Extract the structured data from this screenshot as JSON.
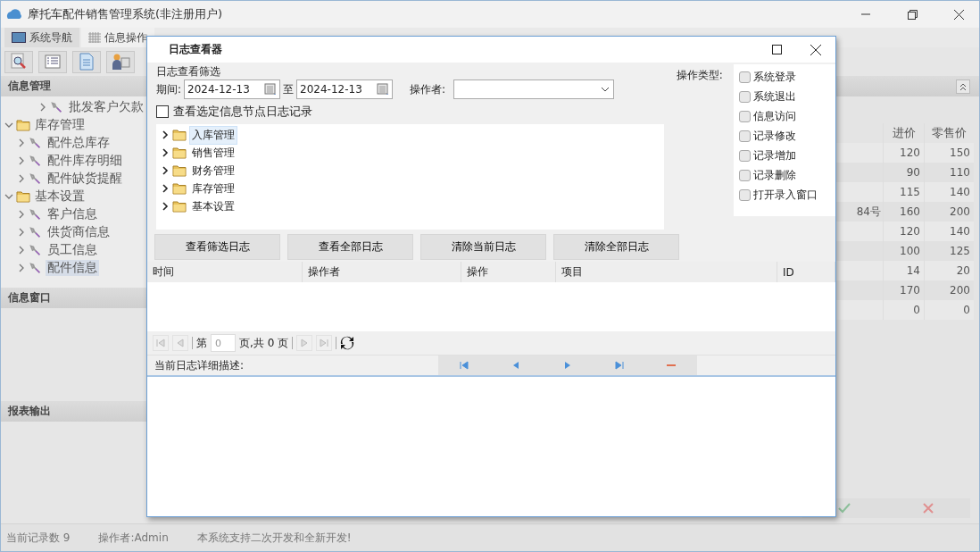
{
  "app": {
    "title": "摩托车配件销售管理系统(非注册用户)"
  },
  "main_tabs": [
    {
      "label": "系统导航",
      "selected": false
    },
    {
      "label": "信息操作",
      "selected": true
    }
  ],
  "nav_panel": {
    "title": "信息管理",
    "tree": [
      {
        "kind": "leaf",
        "label": "批发客户欠款",
        "selected": false
      },
      {
        "kind": "folder",
        "label": "库存管理",
        "expanded": true,
        "children": [
          {
            "kind": "leaf",
            "label": "配件总库存",
            "selected": false
          },
          {
            "kind": "leaf",
            "label": "配件库存明细",
            "selected": false
          },
          {
            "kind": "leaf",
            "label": "配件缺货提醒",
            "selected": false
          }
        ]
      },
      {
        "kind": "folder",
        "label": "基本设置",
        "expanded": true,
        "children": [
          {
            "kind": "leaf",
            "label": "客户信息",
            "selected": false
          },
          {
            "kind": "leaf",
            "label": "供货商信息",
            "selected": false
          },
          {
            "kind": "leaf",
            "label": "员工信息",
            "selected": false
          },
          {
            "kind": "leaf",
            "label": "配件信息",
            "selected": true
          }
        ]
      }
    ]
  },
  "info_window": {
    "title": "信息窗口"
  },
  "report_output": {
    "title": "报表输出"
  },
  "grid": {
    "columns": [
      "进价",
      "零售价"
    ],
    "rows": [
      {
        "cost": "120",
        "retail": "150"
      },
      {
        "cost": "90",
        "retail": "110"
      },
      {
        "cost": "115",
        "retail": "140"
      },
      {
        "column_3": "84号",
        "cost": "160",
        "retail": "200"
      },
      {
        "cost": "120",
        "retail": "140"
      },
      {
        "cost": "100",
        "retail": "125"
      },
      {
        "cost": "14",
        "retail": "20"
      },
      {
        "cost": "170",
        "retail": "200"
      },
      {
        "cost": "0",
        "retail": "0"
      }
    ]
  },
  "status_bar": [
    "当前记录数 9",
    "操作者:Admin",
    "本系统支持二次开发和全新开发!"
  ],
  "dialog": {
    "title": "日志查看器",
    "filter_title": "日志查看筛选",
    "period_label": "期间:",
    "date_from": "2024-12-13",
    "to_label": "至",
    "date_to": "2024-12-13",
    "operator_label": "操作者:",
    "op_type_label": "操作类型:",
    "op_types": [
      {
        "label": "系统登录",
        "checked": false
      },
      {
        "label": "系统退出",
        "checked": false
      },
      {
        "label": "信息访问",
        "checked": false
      },
      {
        "label": "记录修改",
        "checked": false
      },
      {
        "label": "记录增加",
        "checked": false
      },
      {
        "label": "记录删除",
        "checked": false
      },
      {
        "label": "打开录入窗口",
        "checked": false
      }
    ],
    "node_filter": {
      "label": "查看选定信息节点日志记录",
      "checked": false
    },
    "node_tree": [
      {
        "label": "入库管理",
        "selected": true
      },
      {
        "label": "销售管理",
        "selected": false
      },
      {
        "label": "财务管理",
        "selected": false
      },
      {
        "label": "库存管理",
        "selected": false
      },
      {
        "label": "基本设置",
        "selected": false
      }
    ],
    "buttons": [
      "查看筛选日志",
      "查看全部日志",
      "清除当前日志",
      "清除全部日志"
    ],
    "log_columns": [
      "时间",
      "操作者",
      "操作",
      "项目",
      "ID"
    ],
    "pager": {
      "page_prefix": "第",
      "page_value": "0",
      "page_suffix": "页,共 0 页"
    },
    "detail_label": "当前日志详细描述:"
  }
}
